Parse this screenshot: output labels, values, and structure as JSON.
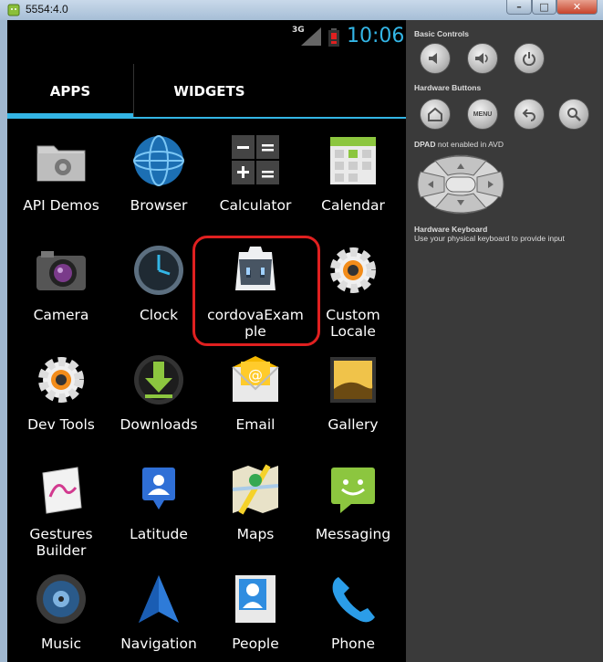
{
  "window": {
    "title": "5554:4.0",
    "min_label": "–",
    "max_label": "□",
    "close_label": "✕"
  },
  "status": {
    "network": "3G",
    "time": "10:06",
    "battery_color": "#e02020"
  },
  "tabs": [
    {
      "label": "APPS",
      "selected": true
    },
    {
      "label": "WIDGETS",
      "selected": false
    }
  ],
  "apps": [
    {
      "label": "API Demos",
      "icon": "folder-gear-icon"
    },
    {
      "label": "Browser",
      "icon": "globe-icon"
    },
    {
      "label": "Calculator",
      "icon": "calculator-icon"
    },
    {
      "label": "Calendar",
      "icon": "calendar-icon"
    },
    {
      "label": "Camera",
      "icon": "camera-icon"
    },
    {
      "label": "Clock",
      "icon": "clock-icon"
    },
    {
      "label": "cordovaExam\nple",
      "icon": "cordova-icon"
    },
    {
      "label": "Custom\nLocale",
      "icon": "gear-icon"
    },
    {
      "label": "Dev Tools",
      "icon": "gear-icon"
    },
    {
      "label": "Downloads",
      "icon": "download-icon"
    },
    {
      "label": "Email",
      "icon": "email-icon"
    },
    {
      "label": "Gallery",
      "icon": "gallery-icon"
    },
    {
      "label": "Gestures\nBuilder",
      "icon": "gesture-icon"
    },
    {
      "label": "Latitude",
      "icon": "latitude-icon"
    },
    {
      "label": "Maps",
      "icon": "maps-icon"
    },
    {
      "label": "Messaging",
      "icon": "messaging-icon"
    },
    {
      "label": "Music",
      "icon": "music-icon"
    },
    {
      "label": "Navigation",
      "icon": "navigation-icon"
    },
    {
      "label": "People",
      "icon": "people-icon"
    },
    {
      "label": "Phone",
      "icon": "phone-icon"
    }
  ],
  "panel": {
    "basic_controls": "Basic Controls",
    "hardware_buttons": "Hardware Buttons",
    "menu_label": "MENU",
    "dpad_title": "DPAD",
    "dpad_note": " not enabled in AVD",
    "keyboard_title": "Hardware Keyboard",
    "keyboard_text": "Use your physical keyboard to provide input"
  },
  "colors": {
    "accent": "#33b5e5",
    "highlight": "#e02020",
    "panel_bg": "#3a3a3a"
  }
}
